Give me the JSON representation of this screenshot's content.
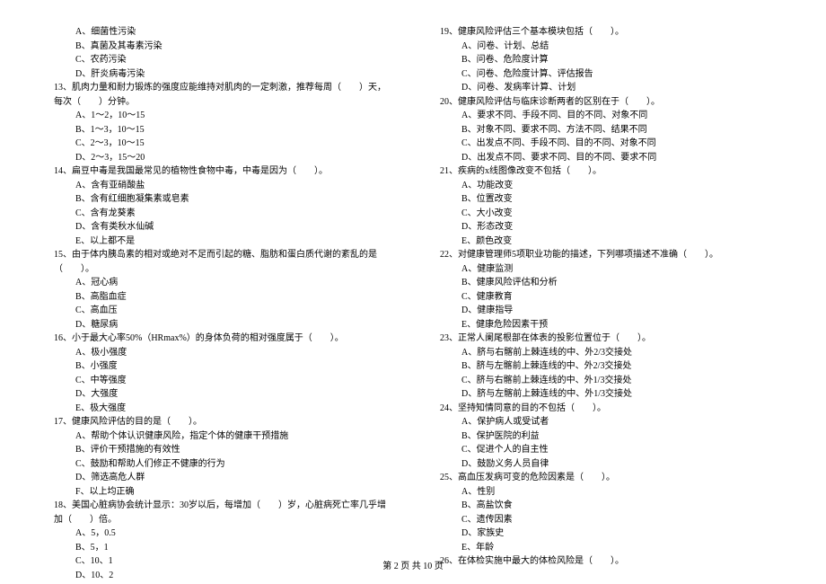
{
  "left": {
    "options_1": [
      "A、细菌性污染",
      "B、真菌及其毒素污染",
      "C、农药污染",
      "D、肝炎病毒污染"
    ],
    "q13": "13、肌肉力量和耐力锻炼的强度应能维持对肌肉的一定刺激，推荐每周（　　）天，每次（　　）分钟。",
    "options_13": [
      "A、1～2，10～15",
      "B、1～3，10～15",
      "C、2～3，10～15",
      "D、2～3，15～20"
    ],
    "q14": "14、扁豆中毒是我国最常见的植物性食物中毒，中毒是因为（　　）。",
    "options_14": [
      "A、含有亚硝酸盐",
      "B、含有红细胞凝集素或皂素",
      "C、含有龙葵素",
      "D、含有类秋水仙碱",
      "E、以上都不是"
    ],
    "q15": "15、由于体内胰岛素的相对或绝对不足而引起的糖、脂肪和蛋白质代谢的紊乱的是（　　）。",
    "options_15": [
      "A、冠心病",
      "B、高脂血症",
      "C、高血压",
      "D、糖尿病"
    ],
    "q16": "16、小于最大心率50%（HRmax%）的身体负荷的相对强度属于（　　）。",
    "options_16": [
      "A、极小强度",
      "B、小强度",
      "C、中等强度",
      "D、大强度",
      "E、极大强度"
    ],
    "q17": "17、健康风险评估的目的是（　　）。",
    "options_17": [
      "A、帮助个体认识健康风险，指定个体的健康干预措施",
      "B、评价干预措施的有效性",
      "C、鼓励和帮助人们修正不健康的行为",
      "D、筛选高危人群",
      "F、以上均正确"
    ],
    "q18": "18、美国心脏病协会统计显示：30岁以后，每增加（　　）岁，心脏病死亡率几乎增加（　　）倍。",
    "options_18": [
      "A、5，0.5",
      "B、5，1",
      "C、10、1",
      "D、10、2"
    ]
  },
  "right": {
    "q19": "19、健康风险评估三个基本模块包括（　　）。",
    "options_19": [
      "A、问卷、计划、总结",
      "B、问卷、危险度计算",
      "C、问卷、危险度计算、评估报告",
      "D、问卷、发病率计算、计划"
    ],
    "q20": "20、健康风险评估与临床诊断两者的区别在于（　　）。",
    "options_20": [
      "A、要求不同、手段不同、目的不同、对象不同",
      "B、对象不同、要求不同、方法不同、结果不同",
      "C、出发点不同、手段不同、目的不同、对象不同",
      "D、出发点不同、要求不同、目的不同、要求不同"
    ],
    "q21": "21、疾病的x线图像改变不包括（　　）。",
    "options_21": [
      "A、功能改变",
      "B、位置改变",
      "C、大小改变",
      "D、形态改变",
      "E、颜色改变"
    ],
    "q22": "22、对健康管理师5项职业功能的描述，下列哪项描述不准确（　　）。",
    "options_22": [
      "A、健康监测",
      "B、健康风险评估和分析",
      "C、健康教育",
      "D、健康指导",
      "E、健康危险因素干预"
    ],
    "q23": "23、正常人阑尾根部在体表的投影位置位于（　　）。",
    "options_23": [
      "A、脐与右髂前上棘连线的中、外2/3交接处",
      "B、脐与左髂前上棘连线的中、外2/3交接处",
      "C、脐与右髂前上棘连线的中、外1/3交接处",
      "D、脐与左髂前上棘连线的中、外1/3交接处"
    ],
    "q24": "24、坚持知情同意的目的不包括（　　）。",
    "options_24": [
      "A、保护病人或受试者",
      "B、保护医院的利益",
      "C、促进个人的自主性",
      "D、鼓励义务人员自律"
    ],
    "q25": "25、高血压发病可变的危险因素是（　　）。",
    "options_25": [
      "A、性别",
      "B、高盐饮食",
      "C、遗传因素",
      "D、家族史",
      "E、年龄"
    ],
    "q26": "26、在体检实施中最大的体检风险是（　　）。"
  },
  "footer": "第 2 页 共 10 页"
}
